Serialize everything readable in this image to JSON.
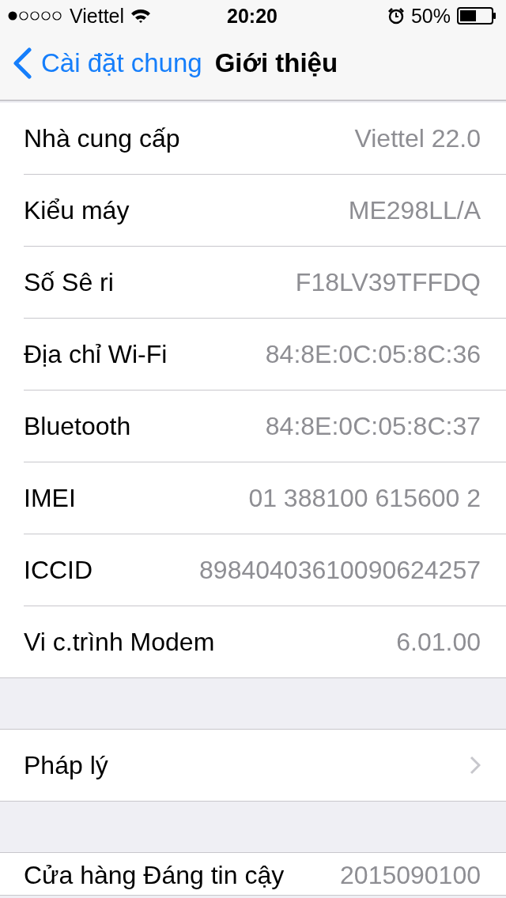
{
  "status_bar": {
    "carrier": "Viettel",
    "time": "20:20",
    "battery_percent": "50%"
  },
  "nav_bar": {
    "back_label": "Cài đặt chung",
    "title": "Giới thiệu"
  },
  "sections": [
    {
      "rows": [
        {
          "kind": "value",
          "label": "Nhà cung cấp",
          "value": "Viettel 22.0"
        },
        {
          "kind": "value",
          "label": "Kiểu máy",
          "value": "ME298LL/A"
        },
        {
          "kind": "value",
          "label": "Số Sê ri",
          "value": "F18LV39TFFDQ"
        },
        {
          "kind": "value",
          "label": "Địa chỉ Wi-Fi",
          "value": "84:8E:0C:05:8C:36"
        },
        {
          "kind": "value",
          "label": "Bluetooth",
          "value": "84:8E:0C:05:8C:37"
        },
        {
          "kind": "value",
          "label": "IMEI",
          "value": "01 388100 615600 2"
        },
        {
          "kind": "value",
          "label": "ICCID",
          "value": "89840403610090624257"
        },
        {
          "kind": "value",
          "label": "Vi c.trình Modem",
          "value": "6.01.00"
        }
      ]
    },
    {
      "rows": [
        {
          "kind": "disclosure",
          "label": "Pháp lý"
        }
      ]
    },
    {
      "rows": [
        {
          "kind": "value",
          "label": "Cửa hàng Đáng tin cậy",
          "value": "2015090100"
        }
      ]
    }
  ]
}
